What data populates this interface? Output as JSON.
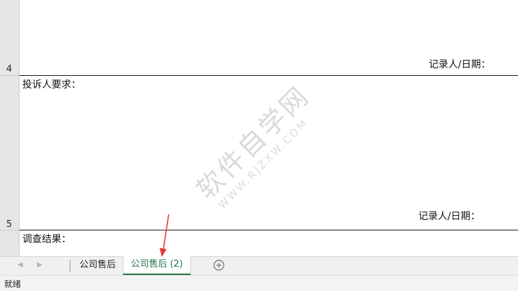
{
  "rows": {
    "row4_number": "4",
    "row5_number": "5"
  },
  "cells": {
    "recorder_date_1": "记录人/日期：",
    "complainant_request": "投诉人要求：",
    "recorder_date_2": "记录人/日期：",
    "investigation_result": "调查结果："
  },
  "watermark": {
    "text": "软件自学网",
    "url": "WWW.RJZXW.COM"
  },
  "tabs": {
    "sheet1_label": "公司售后",
    "sheet2_label": "公司售后 (2)",
    "active": "公司售后 (2)"
  },
  "icons": {
    "prev": "scroll-left-icon",
    "next": "scroll-right-icon",
    "add": "add-sheet-icon"
  },
  "status": {
    "ready": "就绪"
  },
  "colors": {
    "accent": "#217346",
    "annotation": "#e53935"
  }
}
